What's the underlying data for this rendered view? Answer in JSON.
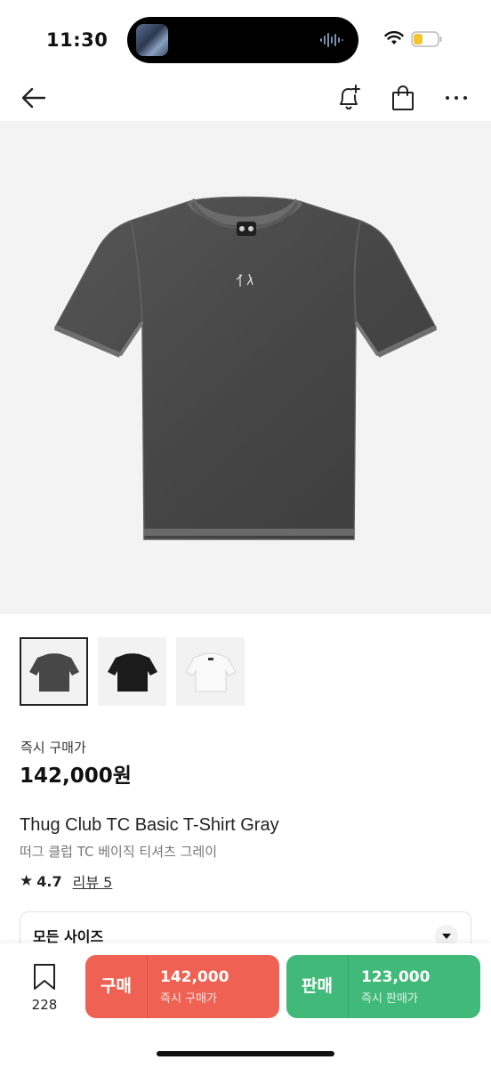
{
  "status_bar": {
    "time": "11:30"
  },
  "nav": {
    "icons": [
      "back-arrow-icon",
      "bell-plus-icon",
      "shopping-bag-icon",
      "more-dots-icon"
    ]
  },
  "product": {
    "price_label": "즉시 구매가",
    "price": "142,000원",
    "name_en": "Thug Club TC Basic T-Shirt Gray",
    "name_ko": "떠그 클럽 TC 베이직 티셔츠 그레이",
    "rating": "4.7",
    "review_label": "리뷰 5",
    "thumbnails": [
      "gray",
      "black",
      "white"
    ],
    "colors": {
      "gray_shirt": "#4a4a4a",
      "black_shirt": "#1b1b1b",
      "white_shirt": "#f7f7f7"
    }
  },
  "size_select": {
    "label": "모든 사이즈"
  },
  "bottom_bar": {
    "wish_count": "228",
    "buy": {
      "label": "구매",
      "price": "142,000",
      "sub": "즉시 구매가",
      "color": "#ef6253"
    },
    "sell": {
      "label": "판매",
      "price": "123,000",
      "sub": "즉시 판매가",
      "color": "#41b979"
    }
  }
}
